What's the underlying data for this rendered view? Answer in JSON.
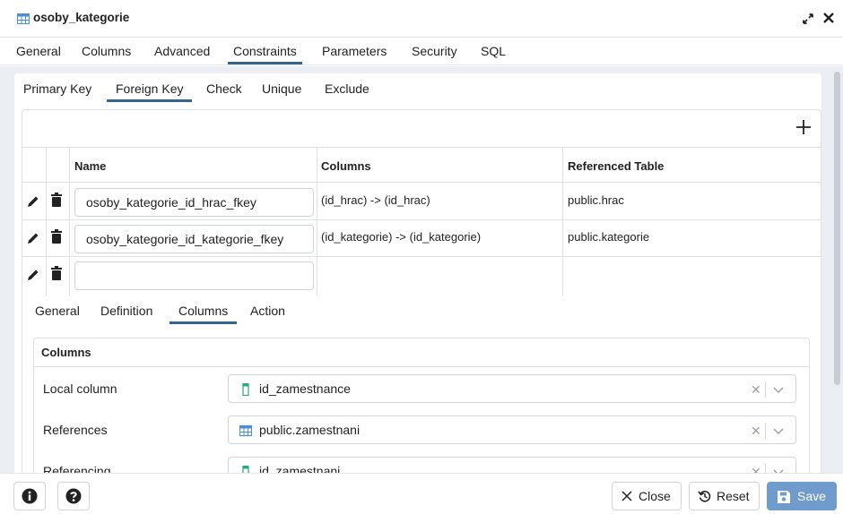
{
  "window": {
    "title": "osoby_kategorie",
    "title_icon": "table-icon",
    "expand_icon": "expand-icon",
    "close_icon": "close-icon"
  },
  "main_tabs": [
    {
      "label": "General"
    },
    {
      "label": "Columns"
    },
    {
      "label": "Advanced"
    },
    {
      "label": "Constraints",
      "active": true
    },
    {
      "label": "Parameters"
    },
    {
      "label": "Security"
    },
    {
      "label": "SQL"
    }
  ],
  "constraint_tabs": [
    {
      "label": "Primary Key"
    },
    {
      "label": "Foreign Key",
      "active": true
    },
    {
      "label": "Check"
    },
    {
      "label": "Unique"
    },
    {
      "label": "Exclude"
    }
  ],
  "fk_grid": {
    "add_icon": "plus-icon",
    "headers": {
      "name": "Name",
      "columns": "Columns",
      "referenced_table": "Referenced Table"
    },
    "rows": [
      {
        "name": "osoby_kategorie_id_hrac_fkey",
        "columns": "(id_hrac) -> (id_hrac)",
        "referenced_table": "public.hrac"
      },
      {
        "name": "osoby_kategorie_id_kategorie_fkey",
        "columns": "(id_kategorie) -> (id_kategorie)",
        "referenced_table": "public.kategorie"
      },
      {
        "name": "",
        "columns": "",
        "referenced_table": ""
      }
    ]
  },
  "detail_tabs": [
    {
      "label": "General"
    },
    {
      "label": "Definition"
    },
    {
      "label": "Columns",
      "active": true
    },
    {
      "label": "Action"
    }
  ],
  "columns_section": {
    "title": "Columns",
    "fields": [
      {
        "label": "Local column",
        "value": "id_zamestnance",
        "icon": "column-icon"
      },
      {
        "label": "References",
        "value": "public.zamestnani",
        "icon": "table-icon"
      },
      {
        "label": "Referencing",
        "value": "id_zamestnani",
        "icon": "column-icon"
      }
    ]
  },
  "footer": {
    "info_icon": "info-icon",
    "help_icon": "help-icon",
    "close_label": "Close",
    "reset_label": "Reset",
    "save_label": "Save"
  },
  "colors": {
    "accent": "#326690",
    "save_button": "#6f9ccc",
    "background": "#ebeef3",
    "column_icon": "#2aa876",
    "table_icon": "#4a8fd1"
  }
}
